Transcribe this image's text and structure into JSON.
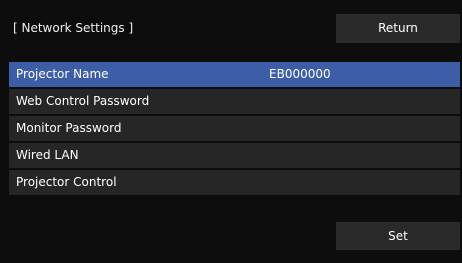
{
  "header": {
    "title": "[ Network Settings ]",
    "return_label": "Return"
  },
  "menu": {
    "items": [
      {
        "label": "Projector Name",
        "value": "EB000000",
        "selected": true
      },
      {
        "label": "Web Control Password",
        "value": ""
      },
      {
        "label": "Monitor Password",
        "value": ""
      },
      {
        "label": "Wired LAN",
        "value": ""
      },
      {
        "label": "Projector Control",
        "value": ""
      }
    ]
  },
  "footer": {
    "set_label": "Set"
  },
  "colors": {
    "background": "#0d0d0d",
    "row_background": "#262626",
    "selected_highlight": "#3d5ea6",
    "button_background": "#2a2a2a",
    "text": "#ffffff"
  }
}
